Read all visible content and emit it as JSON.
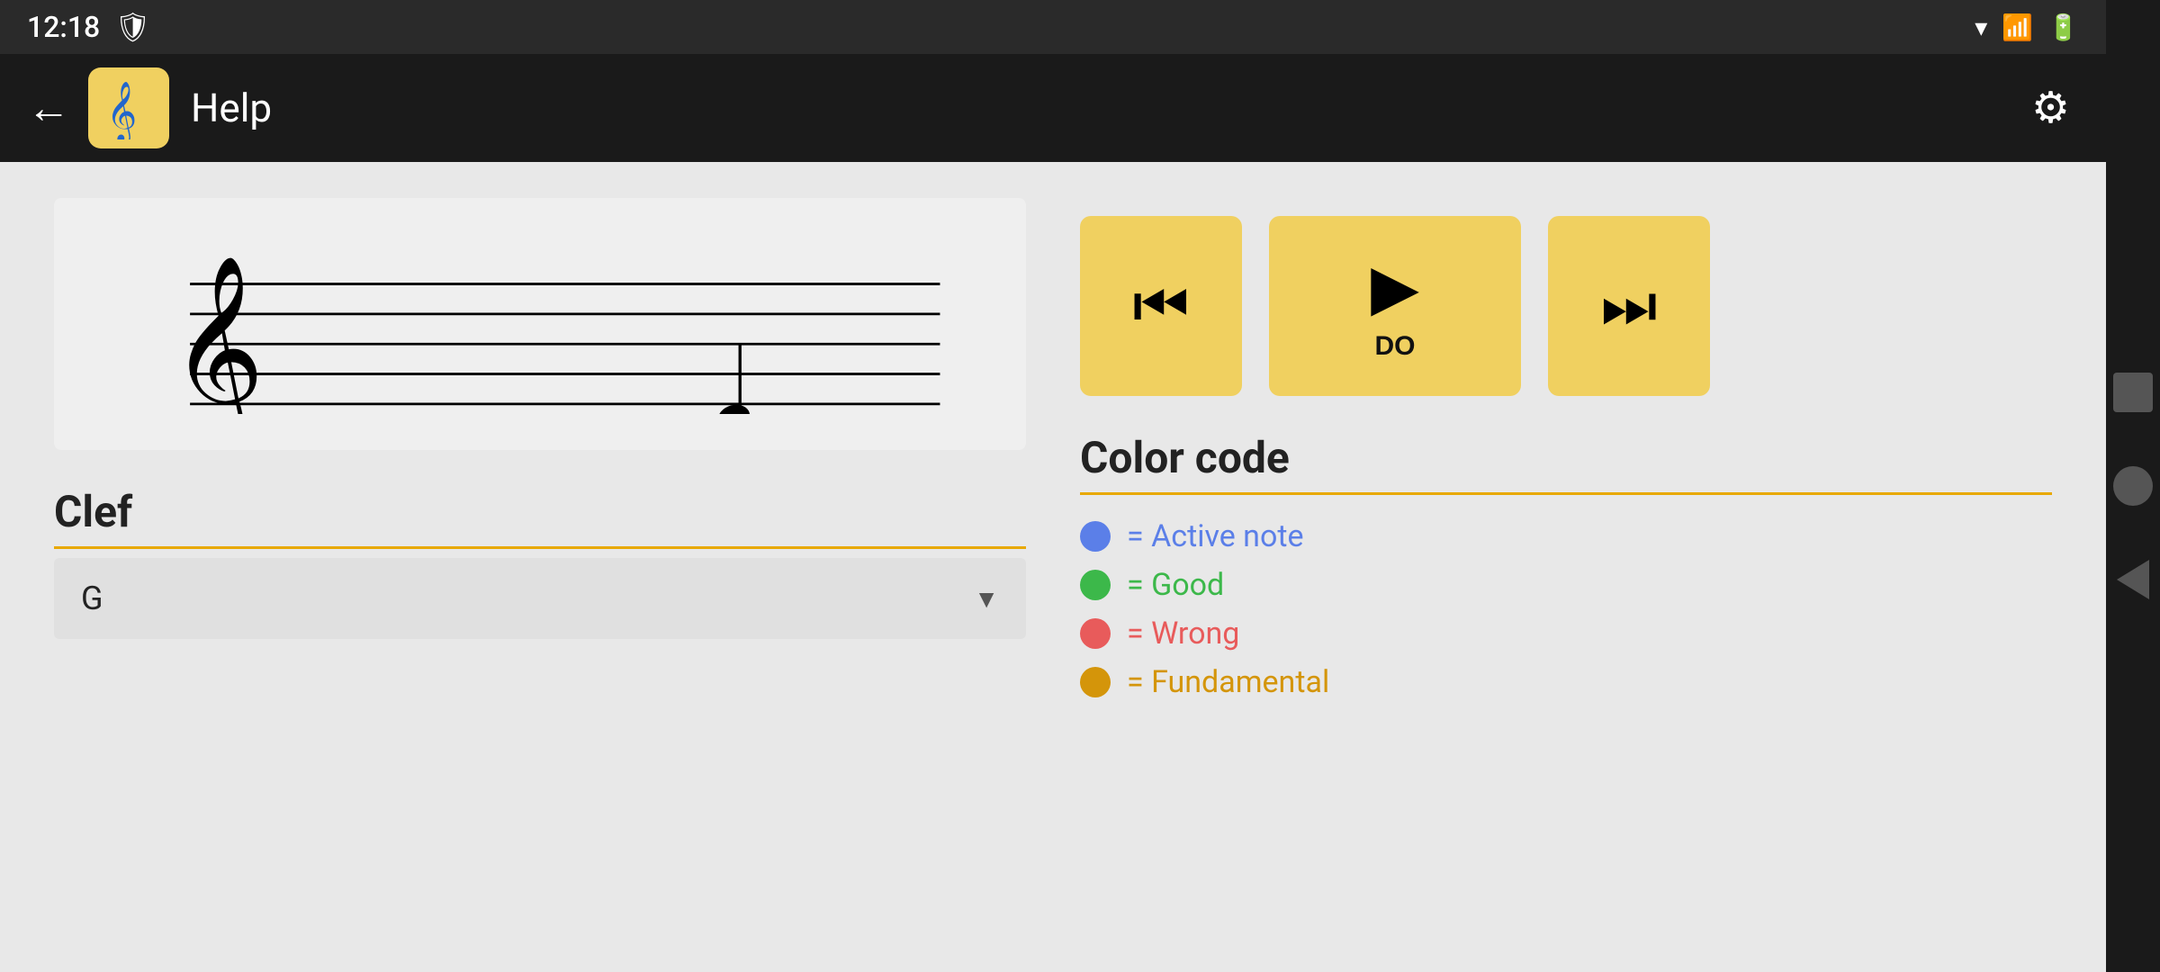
{
  "statusBar": {
    "time": "12:18",
    "icons": [
      "shield-icon",
      "wifi-icon",
      "signal-icon",
      "battery-icon"
    ]
  },
  "appBar": {
    "backLabel": "←",
    "title": "Help",
    "settingsIcon": "⚙"
  },
  "playback": {
    "prevLabel": "⏮",
    "playLabel": "▶",
    "nextLabel": "⏭",
    "noteLabel": "DO"
  },
  "clef": {
    "sectionTitle": "Clef",
    "selectedValue": "G",
    "dropdownArrow": "▼"
  },
  "colorCode": {
    "sectionTitle": "Color code",
    "items": [
      {
        "color": "#5b7fe8",
        "label": "= Active note"
      },
      {
        "color": "#3cb84a",
        "label": "= Good"
      },
      {
        "color": "#e85b5b",
        "label": "= Wrong"
      },
      {
        "color": "#d4950a",
        "label": "= Fundamental"
      }
    ]
  },
  "sideNav": {
    "square": "square",
    "circle": "circle",
    "triangle": "triangle"
  }
}
